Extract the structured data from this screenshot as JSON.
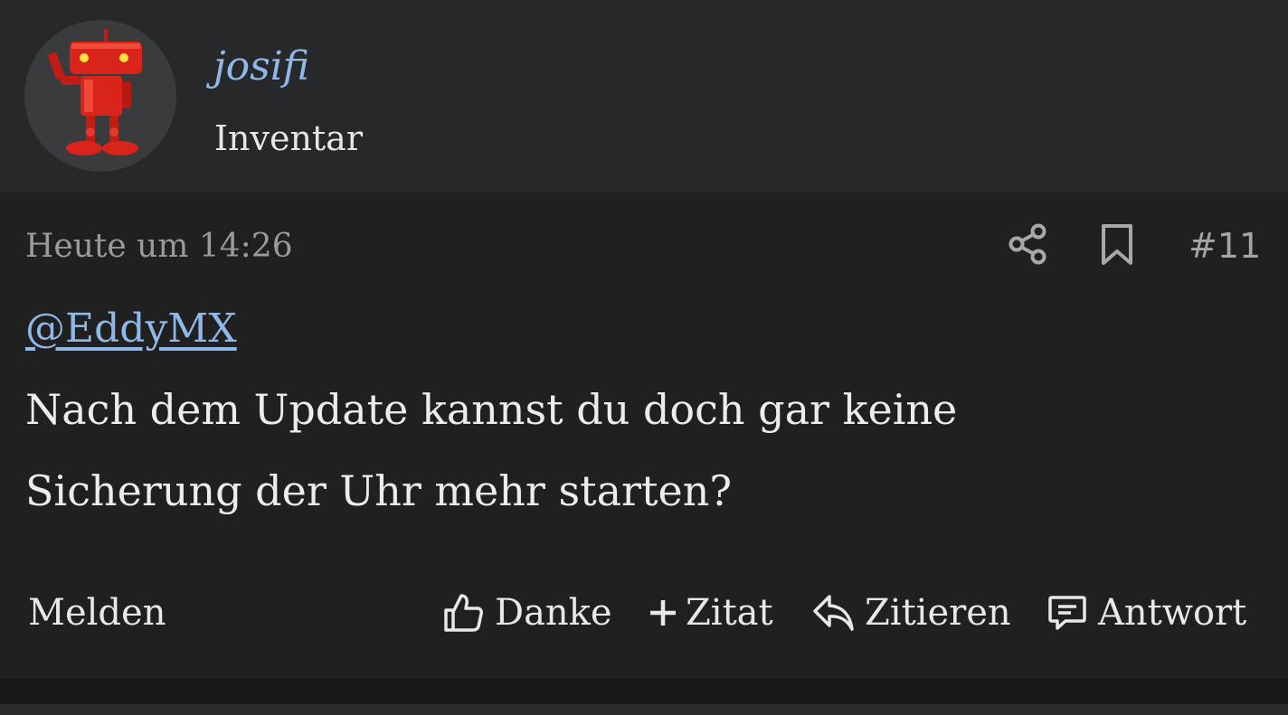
{
  "author": {
    "username": "josifi",
    "title": "Inventar",
    "avatar": "red-robot-avatar"
  },
  "post": {
    "timestamp": "Heute um 14:26",
    "number": "#11",
    "mention": "@EddyMX",
    "lines": [
      "Nach dem Update kannst du doch gar keine",
      "Sicherung der Uhr mehr starten?"
    ]
  },
  "actions": {
    "report": "Melden",
    "like": "Danke",
    "quote_add": "Zitat",
    "quote": "Zitieren",
    "reply": "Antwort"
  },
  "icons": {
    "share": "share-icon",
    "bookmark": "bookmark-icon",
    "thumbs_up": "thumbs-up-icon",
    "plus": "plus-icon",
    "reply": "reply-arrow-icon",
    "comment": "comment-icon"
  },
  "colors": {
    "link": "#8fb8e8",
    "header_bg": "#27282a",
    "post_bg": "#202021",
    "text": "#ececec",
    "muted": "#9a9a9a"
  }
}
